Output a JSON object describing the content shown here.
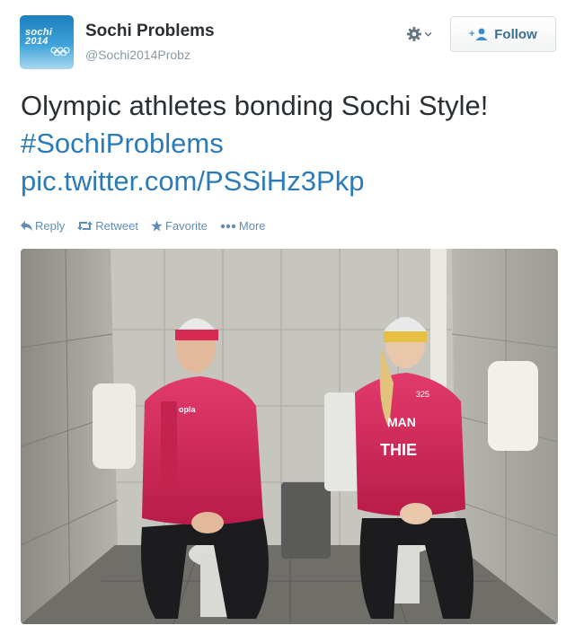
{
  "account": {
    "name": "Sochi Problems",
    "handle": "@Sochi2014Probz",
    "avatar_text": "sochi 2014"
  },
  "header": {
    "follow_label": "Follow"
  },
  "tweet": {
    "text_plain": "Olympic athletes bonding Sochi Style!",
    "hashtag": "#SochiProblems",
    "link": "pic.twitter.com/PSSiHz3Pkp"
  },
  "actions": {
    "reply": "Reply",
    "retweet": "Retweet",
    "favorite": "Favorite",
    "more": "More"
  },
  "photo": {
    "jacket_text_left": "opla",
    "jacket_text_right": "MAN",
    "jacket_text_right2": "THIE",
    "bib_number": "325"
  },
  "colors": {
    "link": "#2b7bb9",
    "action": "#5f8db5",
    "handle": "#8899a6",
    "jacket": "#d8295a"
  }
}
